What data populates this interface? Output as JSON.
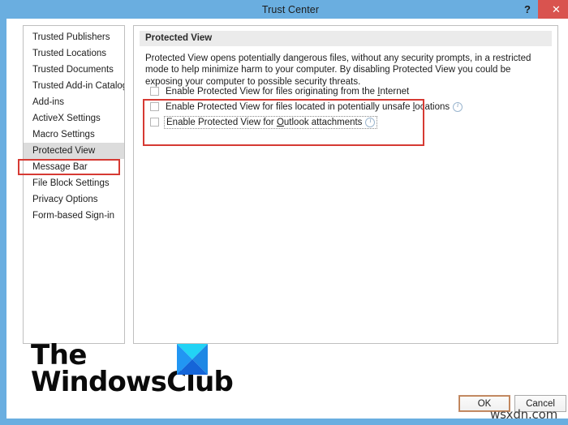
{
  "window": {
    "title": "Trust Center",
    "help_button": "?",
    "close_button": "✕",
    "titlebar_color": "#6aaee0",
    "close_button_color": "#d9534f"
  },
  "sidebar": {
    "items": [
      {
        "label": "Trusted Publishers",
        "selected": false
      },
      {
        "label": "Trusted Locations",
        "selected": false
      },
      {
        "label": "Trusted Documents",
        "selected": false
      },
      {
        "label": "Trusted Add-in Catalogs",
        "selected": false
      },
      {
        "label": "Add-ins",
        "selected": false
      },
      {
        "label": "ActiveX Settings",
        "selected": false
      },
      {
        "label": "Macro Settings",
        "selected": false
      },
      {
        "label": "Protected View",
        "selected": true
      },
      {
        "label": "Message Bar",
        "selected": false
      },
      {
        "label": "File Block Settings",
        "selected": false
      },
      {
        "label": "Privacy Options",
        "selected": false
      },
      {
        "label": "Form-based Sign-in",
        "selected": false
      }
    ]
  },
  "content": {
    "section_title": "Protected View",
    "description": "Protected View opens potentially dangerous files, without any security prompts, in a restricted mode to help minimize harm to your computer. By disabling Protected View you could be exposing your computer to possible security threats.",
    "checkboxes": [
      {
        "label_before": "Enable Protected View for files originating from the ",
        "label_underlined": "I",
        "label_after": "nternet",
        "checked": false,
        "has_info_icon": false,
        "focused": false
      },
      {
        "label_before": "Enable Protected View for files located in potentially unsafe ",
        "label_underlined": "l",
        "label_after": "ocations",
        "checked": false,
        "has_info_icon": true,
        "focused": false
      },
      {
        "label_before": "Enable Protected View for ",
        "label_underlined": "O",
        "label_after": "utlook attachments",
        "checked": false,
        "has_info_icon": true,
        "focused": true
      }
    ]
  },
  "annotations": {
    "highlight_color": "#d63a33",
    "sidebar_highlight_target": "Protected View",
    "checkbox_group_highlight": true
  },
  "footer": {
    "ok_label": "OK",
    "cancel_label": "Cancel"
  },
  "watermark": {
    "brand_line1": "The",
    "brand_line2": "WindowsClub",
    "site": "wsxdn.com",
    "logo_colors": {
      "top": "#22d3f5",
      "left": "#2196f3",
      "right": "#1e88e5",
      "bottom": "#1565d8"
    }
  }
}
